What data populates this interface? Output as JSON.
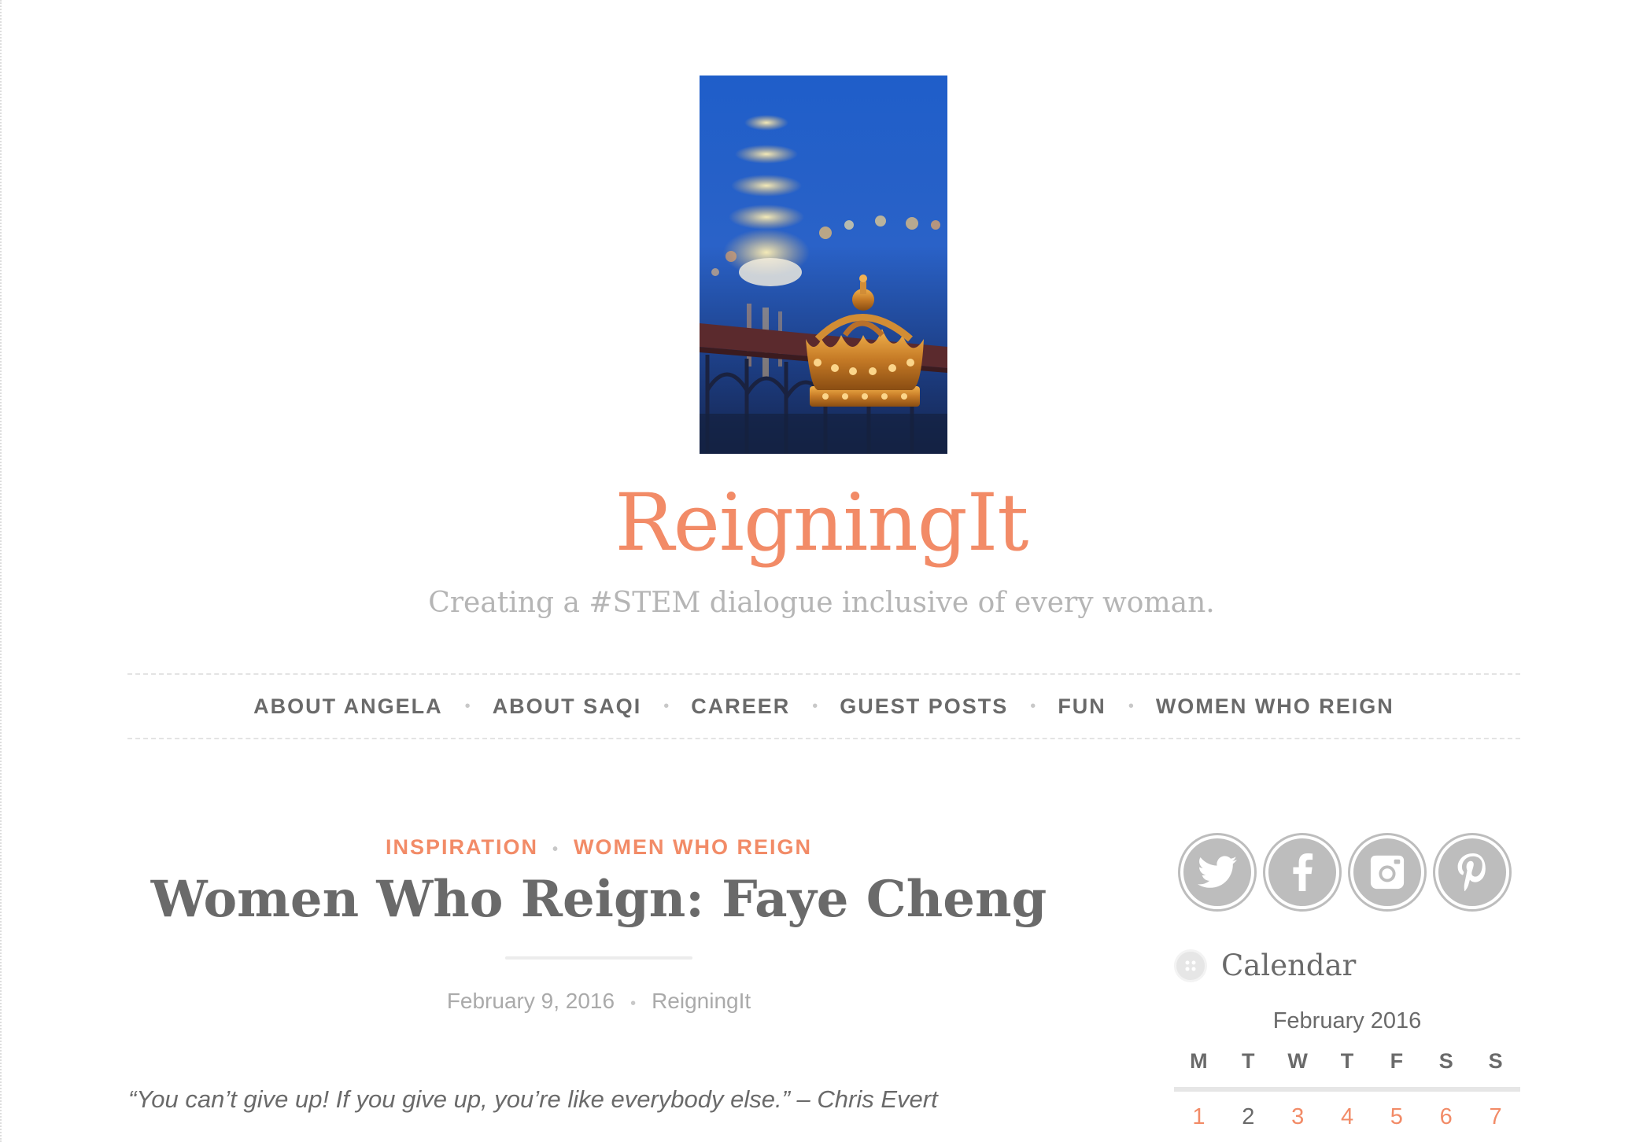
{
  "site": {
    "title": "ReigningIt",
    "description": "Creating a #STEM dialogue inclusive of every woman."
  },
  "nav": {
    "items": [
      {
        "label": "ABOUT ANGELA"
      },
      {
        "label": "ABOUT SAQI"
      },
      {
        "label": "CAREER"
      },
      {
        "label": "GUEST POSTS"
      },
      {
        "label": "FUN"
      },
      {
        "label": "WOMEN WHO REIGN"
      }
    ],
    "separator": "•"
  },
  "post": {
    "categories": [
      "INSPIRATION",
      "WOMEN WHO REIGN"
    ],
    "title": "Women Who Reign: Faye Cheng",
    "date": "February 9, 2016",
    "author": "ReigningIt",
    "quote": "“You can’t give up! If you give up, you’re like everybody else.” – Chris Evert"
  },
  "sidebar": {
    "social": [
      {
        "icon": "twitter-icon"
      },
      {
        "icon": "facebook-icon"
      },
      {
        "icon": "instagram-icon"
      },
      {
        "icon": "pinterest-icon"
      }
    ],
    "calendar": {
      "title": "Calendar",
      "caption": "February 2016",
      "days": [
        "M",
        "T",
        "W",
        "T",
        "F",
        "S",
        "S"
      ],
      "first_row": [
        {
          "day": "1",
          "linked": true
        },
        {
          "day": "2",
          "linked": false
        },
        {
          "day": "3",
          "linked": true
        },
        {
          "day": "4",
          "linked": true
        },
        {
          "day": "5",
          "linked": true
        },
        {
          "day": "6",
          "linked": true
        },
        {
          "day": "7",
          "linked": true
        }
      ]
    }
  },
  "colors": {
    "accent": "#f28b67",
    "text": "#6a6a6a",
    "muted": "#b5b5b5",
    "social_bg": "#bdbdbd"
  }
}
